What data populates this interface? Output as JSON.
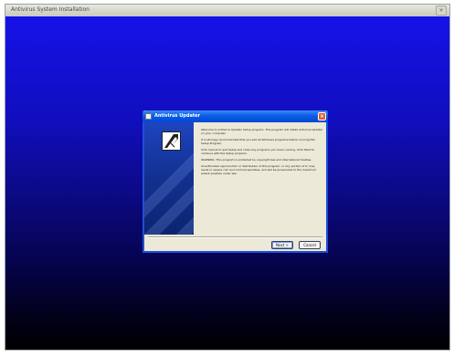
{
  "window": {
    "title": "Antivirus System Installation",
    "close_glyph": "×"
  },
  "dialog": {
    "title": "Antivirus Updater",
    "close_glyph": "×",
    "paragraphs": [
      "Welcome to Antivirus Updater Setup program. This program will install Antivirus Updater on your computer.",
      "It is strongly recommended that you exit all Windows programs before running this Setup Program.",
      "Click Cancel to quit Setup and close any programs you have running. Click Next to continue with the Setup program.",
      "WARNING: This program is protected by copyright law and international treaties.",
      "Unauthorized reproduction or distribution of this program, or any portion of it, may result in severe civil and criminal penalties, and will be prosecuted to the maximum extent possible under law."
    ],
    "buttons": {
      "next": "Next >",
      "cancel": "Cancel"
    }
  },
  "icons": [
    "installer-icon",
    "close-icon",
    "setup-logo-icon"
  ],
  "colors": {
    "desktop_top": "#1612e8",
    "desktop_bottom": "#000000",
    "dialog_titlebar": "#0a5ee3",
    "dialog_body": "#ece9d8",
    "side_panel": "#12308f",
    "close_button": "#e25a2c"
  }
}
